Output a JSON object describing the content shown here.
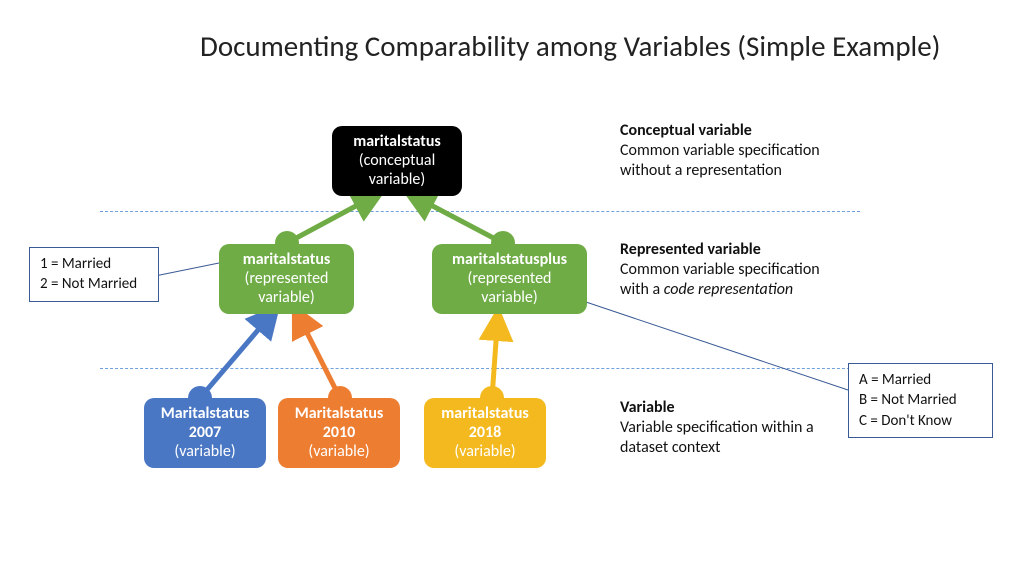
{
  "title": "Documenting Comparability among Variables (Simple Example)",
  "nodes": {
    "conceptual": {
      "name": "maritalstatus",
      "type": "(conceptual variable)"
    },
    "rep1": {
      "name": "maritalstatus",
      "type": "(represented variable)"
    },
    "rep2": {
      "name": "maritalstatusplus",
      "type": "(represented variable)"
    },
    "var1": {
      "name": "Maritalstatus 2007",
      "type": "(variable)"
    },
    "var2": {
      "name": "Maritalstatus 2010",
      "type": "(variable)"
    },
    "var3": {
      "name": "maritalstatus 2018",
      "type": "(variable)"
    }
  },
  "descriptions": {
    "conceptual": {
      "heading": "Conceptual variable",
      "body": "Common variable specification without a representation"
    },
    "represented": {
      "heading": "Represented variable",
      "body_pre": "Common variable specification with a ",
      "body_em": "code representation"
    },
    "variable": {
      "heading": "Variable",
      "body": "Variable specification within a dataset context"
    }
  },
  "codes": {
    "left": [
      "1 = Married",
      "2 = Not Married"
    ],
    "right": [
      "A = Married",
      "B = Not Married",
      "C = Don't Know"
    ]
  },
  "colors": {
    "green": "#6fac46",
    "blue": "#4a77c4",
    "orange": "#ed7d31",
    "yellow": "#f3b91f"
  }
}
